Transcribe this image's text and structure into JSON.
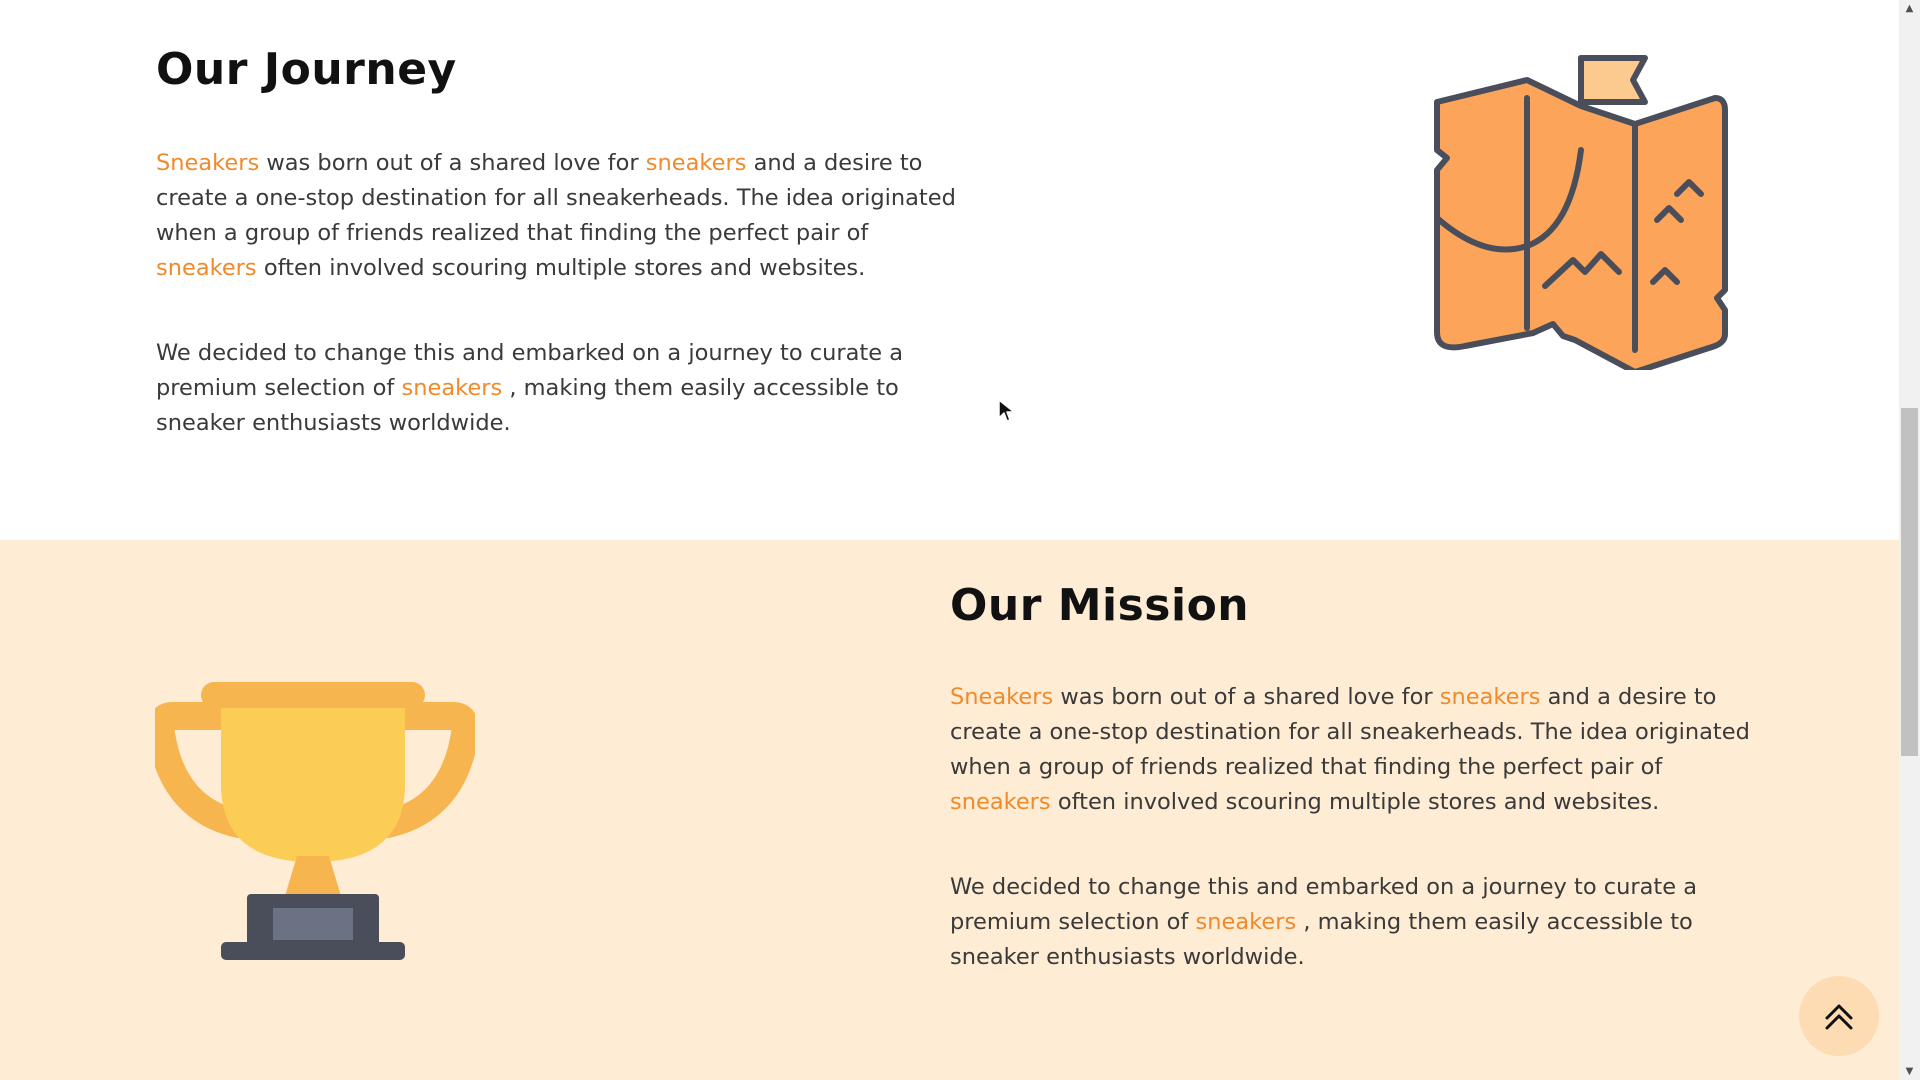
{
  "journey": {
    "title": "Our Journey",
    "p1": {
      "s1": "Sneakers",
      "s2": " was born out of a shared love for ",
      "s3": "sneakers",
      "s4": " and a desire to create a one-stop destination for all sneakerheads. The idea originated when a group of friends realized that finding the perfect pair of ",
      "s5": "sneakers",
      "s6": " often involved scouring multiple stores and websites."
    },
    "p2": {
      "s1": "We decided to change this and embarked on a journey to curate a premium selection of ",
      "s2": "sneakers",
      "s3": " , making them easily accessible to sneaker enthusiasts worldwide."
    },
    "illustration": "map-icon"
  },
  "mission": {
    "title": "Our Mission",
    "p1": {
      "s1": "Sneakers",
      "s2": " was born out of a shared love for ",
      "s3": "sneakers",
      "s4": " and a desire to create a one-stop destination for all sneakerheads. The idea originated when a group of friends realized that finding the perfect pair of ",
      "s5": "sneakers",
      "s6": " often involved scouring multiple stores and websites."
    },
    "p2": {
      "s1": "We decided to change this and embarked on a journey to curate a premium selection of ",
      "s2": "sneakers",
      "s3": " , making them easily accessible to sneaker enthusiasts worldwide."
    },
    "illustration": "trophy-icon"
  },
  "back_to_top": {
    "icon": "double-chevron-up-icon"
  },
  "colors": {
    "accent": "#f08a2a",
    "mission_bg": "#feecd4",
    "text": "#3a3a3a",
    "heading": "#111111"
  }
}
